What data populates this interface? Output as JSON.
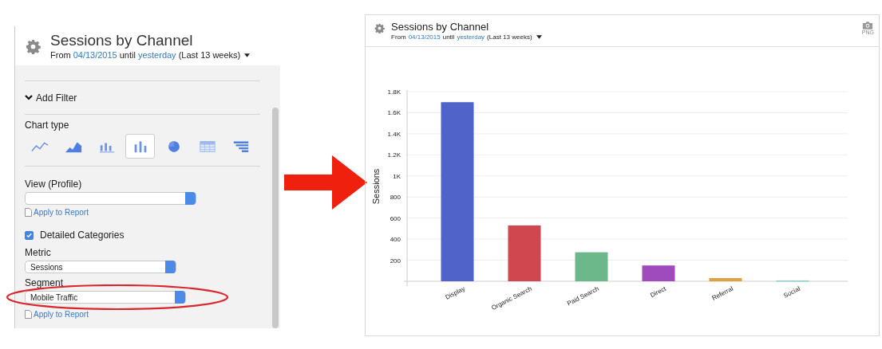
{
  "left_panel": {
    "header": {
      "title": "Sessions by Channel",
      "range": {
        "prefix": "From",
        "start": "04/13/2015",
        "middle": "until",
        "end": "yesterday",
        "suffix": "(Last 13 weeks)"
      }
    },
    "filter_toggle": {
      "label": "Add Filter"
    },
    "chart_type": {
      "label": "Chart type",
      "options": [
        {
          "kind": "line",
          "selected": false
        },
        {
          "kind": "area",
          "selected": false
        },
        {
          "kind": "stacked",
          "selected": false
        },
        {
          "kind": "bar",
          "selected": true
        },
        {
          "kind": "pie",
          "selected": false
        },
        {
          "kind": "table",
          "selected": false
        },
        {
          "kind": "funnel",
          "selected": false
        }
      ]
    },
    "view_profile": {
      "label": "View (Profile)",
      "link": "Apply to Report"
    },
    "detailed_categories": {
      "label": "Detailed Categories",
      "checked": true
    },
    "metric": {
      "label": "Metric",
      "value": "Sessions"
    },
    "segment": {
      "label": "Segment",
      "value": "Mobile Traffic",
      "link": "Apply to Report",
      "highlighted": true
    }
  },
  "right_panel": {
    "header": {
      "title": "Sessions by Channel",
      "range": {
        "prefix": "From",
        "start": "04/13/2015",
        "middle": "until",
        "end": "yesterday",
        "suffix": "(Last 13 weeks)"
      }
    },
    "export": {
      "label": "PNG"
    },
    "chart_data": {
      "type": "bar",
      "ylabel": "Sessions",
      "categories": [
        "Display",
        "Organic Search",
        "Paid Search",
        "Direct",
        "Referral",
        "Social"
      ],
      "grid": true,
      "series": [
        {
          "colors": [
            "#5063c9",
            "#d0474f",
            "#6db88a",
            "#a04bbd",
            "#e0a040",
            "#8fd0c8"
          ],
          "values": [
            1700,
            530,
            275,
            150,
            30,
            8
          ]
        }
      ],
      "ylim": [
        0,
        1800
      ],
      "yticks": [
        {
          "value": 200,
          "label": "200"
        },
        {
          "value": 400,
          "label": "400"
        },
        {
          "value": 600,
          "label": "600"
        },
        {
          "value": 800,
          "label": "800"
        },
        {
          "value": 1000,
          "label": "1K"
        },
        {
          "value": 1200,
          "label": "1.2K"
        },
        {
          "value": 1400,
          "label": "1.4K"
        },
        {
          "value": 1600,
          "label": "1.6K"
        },
        {
          "value": 1800,
          "label": "1.8K"
        }
      ]
    }
  }
}
